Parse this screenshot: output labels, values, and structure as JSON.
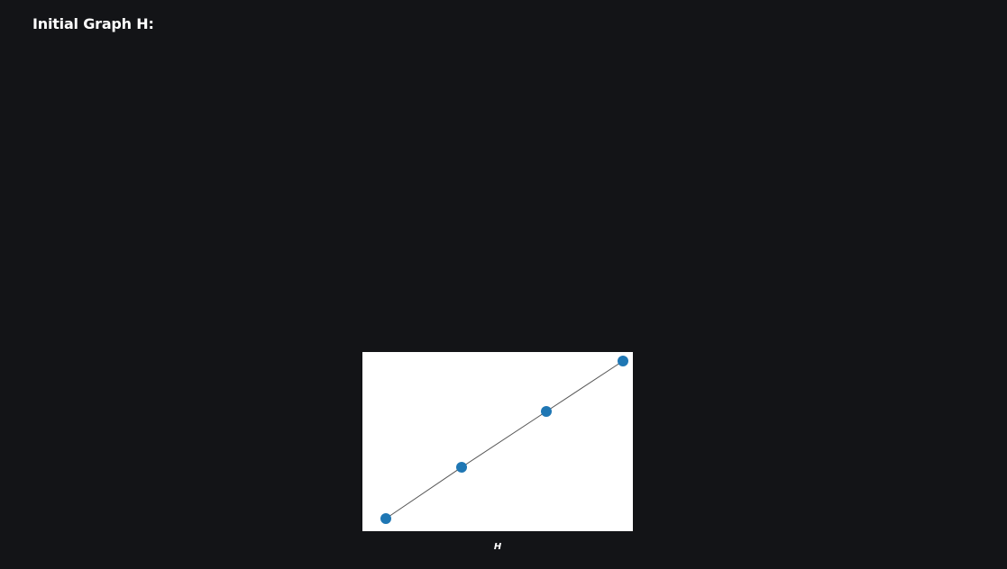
{
  "header": {
    "title": "Initial Graph H:"
  },
  "graph": {
    "label": "H",
    "node_color": "#1f77b4",
    "edge_color": "#555555",
    "background": "#ffffff",
    "nodes": [
      {
        "id": 0
      },
      {
        "id": 1
      },
      {
        "id": 2
      },
      {
        "id": 3
      }
    ],
    "edges": [
      [
        0,
        1
      ],
      [
        1,
        2
      ],
      [
        2,
        3
      ]
    ]
  }
}
